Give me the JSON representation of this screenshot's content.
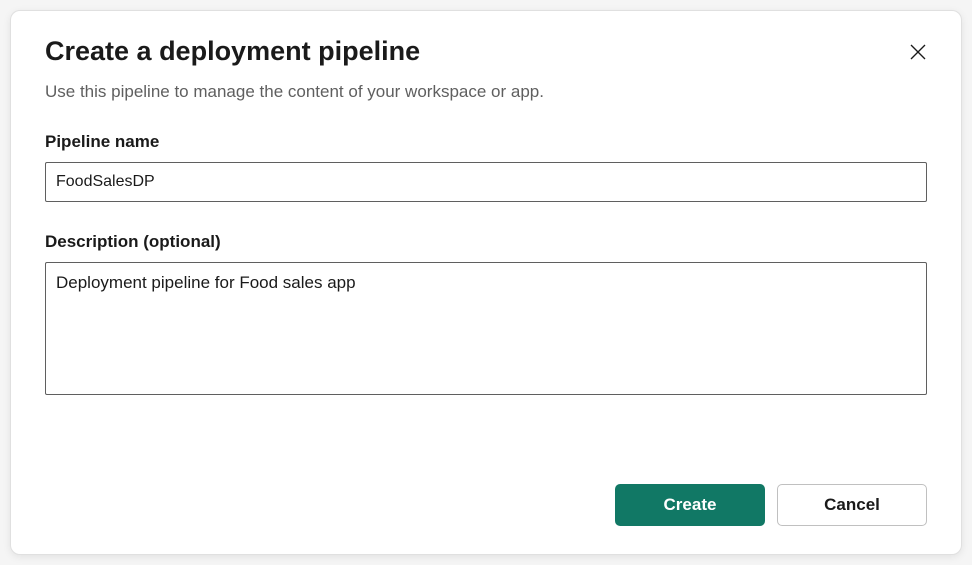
{
  "dialog": {
    "title": "Create a deployment pipeline",
    "subtitle": "Use this pipeline to manage the content of your workspace or app."
  },
  "form": {
    "name_label": "Pipeline name",
    "name_value": "FoodSalesDP",
    "description_label": "Description (optional)",
    "description_value": "Deployment pipeline for Food sales app"
  },
  "footer": {
    "create_label": "Create",
    "cancel_label": "Cancel"
  },
  "colors": {
    "primary": "#117865"
  }
}
